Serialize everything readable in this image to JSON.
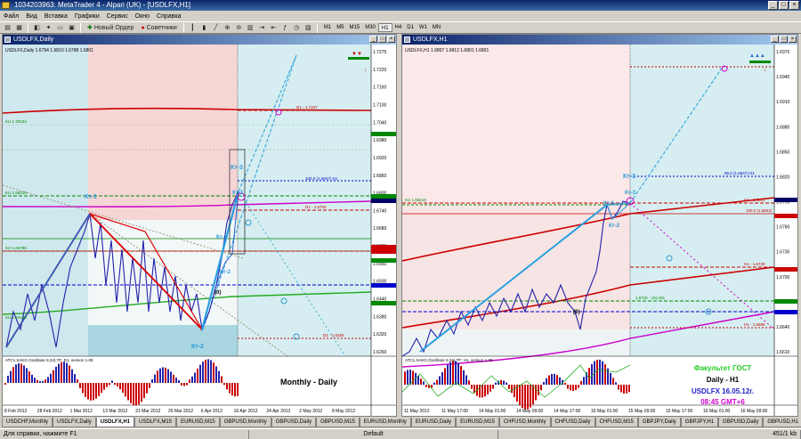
{
  "window": {
    "title": "1034203963: MetaTrader 4 - Alpari (UK) - [USDLFX,H1]"
  },
  "menu": [
    "Файл",
    "Вид",
    "Вставка",
    "Графики",
    "Сервис",
    "Окно",
    "Справка"
  ],
  "toolbar": {
    "new_order": "Новый Ордер",
    "advisors": "Советники",
    "timeframes": [
      "M1",
      "M5",
      "M15",
      "M30",
      "H1",
      "H4",
      "D1",
      "W1",
      "MN"
    ],
    "active_timeframe": "H1"
  },
  "left_chart": {
    "window_title": "USDLFX,Daily",
    "header": "USDLFX,Daily 1.6794 1.6810 1.6788 1.6801",
    "price_labels": [
      "1.7275",
      "1.7220",
      "1.7160",
      "1.7100",
      "1.7040",
      "1.6980",
      "1.6920",
      "1.6860",
      "1.6800",
      "1.6740",
      "1.6680",
      "1.6620",
      "1.6560",
      "1.6500",
      "1.6440",
      "1.6380",
      "1.6320",
      "1.6260"
    ],
    "date_labels": [
      "8 Feb 2012",
      "28 Feb 2012",
      "1 Mar 2012",
      "13 Mar 2012",
      "21 Mar 2012",
      "29 Mar 2012",
      "6 Apr 2012",
      "16 Apr 2012",
      "24 Apr 2012",
      "2 May 2012",
      "8 May 2012"
    ],
    "annotations": {
      "kt1": "Кт-1",
      "kt2": "Кт-2",
      "kt2b": "Кт-2",
      "kt3": "Кт-3",
      "kt3b": "Кт-3",
      "kt1b": "Кт-1",
      "zero": "(0)",
      "d1_top": "D1 - 1.7107",
      "d1_mid": "D1 - 1.6793",
      "d1_low": "D1 - 1.6460",
      "lev100": "100.0 (1.6847) D1",
      "kk1": "KU 1.70234",
      "kk2": "KU 1.68219",
      "kk3": "KU 1.66788",
      "kk4": "KU 1.64188"
    },
    "osc_label": "ATC1.SAKG.Oscillator 8,34),TF: D1, version 1.08",
    "caption": "Monthly - Daily"
  },
  "right_chart": {
    "window_title": "USDLFX,H1",
    "header": "USDLFX,H1 1.6807 1.6812 1.6801 1.6801",
    "price_labels": [
      "1.6970",
      "1.6940",
      "1.6910",
      "1.6880",
      "1.6850",
      "1.6820",
      "1.6790",
      "1.6760",
      "1.6730",
      "1.6700",
      "1.6670",
      "1.6640",
      "1.6610"
    ],
    "date_labels": [
      "11 May 2012",
      "11 May 17:00",
      "14 May 01:00",
      "14 May 09:00",
      "14 May 17:00",
      "15 May 01:00",
      "15 May 09:00",
      "15 May 17:00",
      "16 May 01:00",
      "16 May 09:00"
    ],
    "annotations": {
      "kt1": "Кт-1",
      "kt2": "Кт-2",
      "kt3": "Кт-3",
      "kt3b": "Кт-3",
      "zero": "(0)",
      "h1_a": "H1 - 1.6813",
      "h1_b": "H1 - 1.6749",
      "h1_c": "H1 - 1.6688",
      "lev65": "65.0 (1.6847) H1",
      "kk1": "KU 1.68219",
      "lev": "1.6715 - 161.8%",
      "lev2": "100.0 (1.6823)"
    },
    "osc_label": "ATC1.SAKG.Oscillator 8,34),TF: H1, version 1.08",
    "faculty": "Факультет ГОСТ",
    "caption": "Daily - H1",
    "symbol_date": "USDLFX 16.05.12г.",
    "time": "08:45  GMT+6"
  },
  "tabs": [
    "USDCHF,Monthly",
    "USDLFX,Daily",
    "USDLFX,H1",
    "USDLFX,M15",
    "EURUSD,M15",
    "GBPUSD,Monthly",
    "GBPUSD,Daily",
    "GBPUSD,M15",
    "EURUSD,Monthly",
    "EURUSD,Daily",
    "EURUSD,M15",
    "CHFUSD,Monthly",
    "CHFUSD,Daily",
    "CHFUSD,M15",
    "GBPJPY,Daily",
    "GBPJPY,H1",
    "GBPUSD,Daily",
    "GBPUSD,H1"
  ],
  "active_tab": "USDLFX,H1",
  "status": {
    "help": "Для справки, нажмите F1",
    "profile": "Default",
    "conn": "451/1 kb"
  }
}
